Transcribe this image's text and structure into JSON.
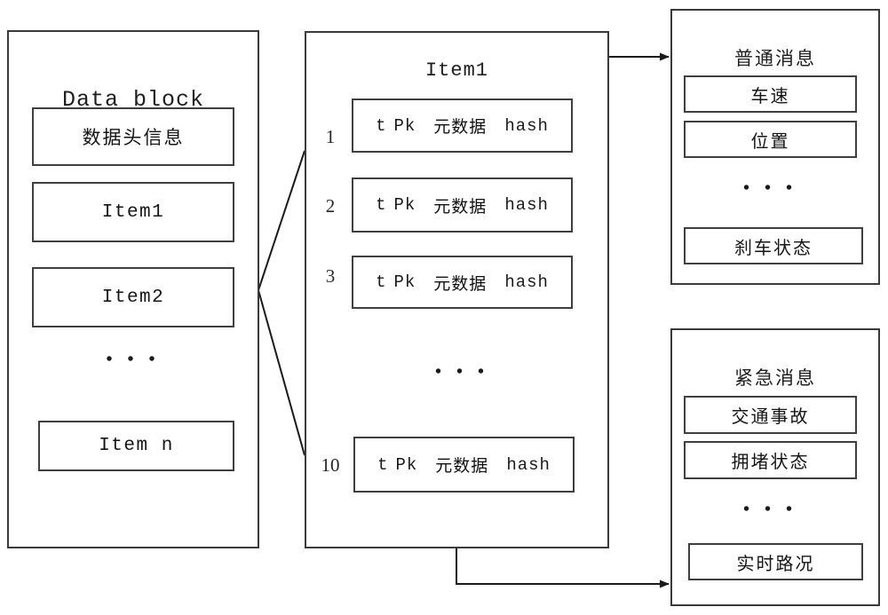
{
  "diagram": {
    "title_font_note": "",
    "data_block": {
      "title": "Data block",
      "items": [
        {
          "label": "数据头信息"
        },
        {
          "label": "Item1"
        },
        {
          "label": "Item2"
        },
        {
          "label": "Item n"
        }
      ],
      "ellipsis": "• • •"
    },
    "item_detail": {
      "title": "Item1",
      "row_numbers": [
        "1",
        "2",
        "3",
        "10"
      ],
      "row_fields": {
        "t": "t",
        "pk": "Pk",
        "metadata": "元数据",
        "hash": "hash"
      },
      "ellipsis": "• • •"
    },
    "normal_message": {
      "title": "普通消息",
      "items": [
        {
          "label": "车速"
        },
        {
          "label": "位置"
        },
        {
          "label": "刹车状态"
        }
      ],
      "ellipsis": "• • •"
    },
    "urgent_message": {
      "title": "紧急消息",
      "items": [
        {
          "label": "交通事故"
        },
        {
          "label": "拥堵状态"
        },
        {
          "label": "实时路况"
        }
      ],
      "ellipsis": "• • •"
    },
    "colors": {
      "stroke": "#3a3a3a",
      "text": "#151515",
      "background": "#ffffff"
    }
  }
}
